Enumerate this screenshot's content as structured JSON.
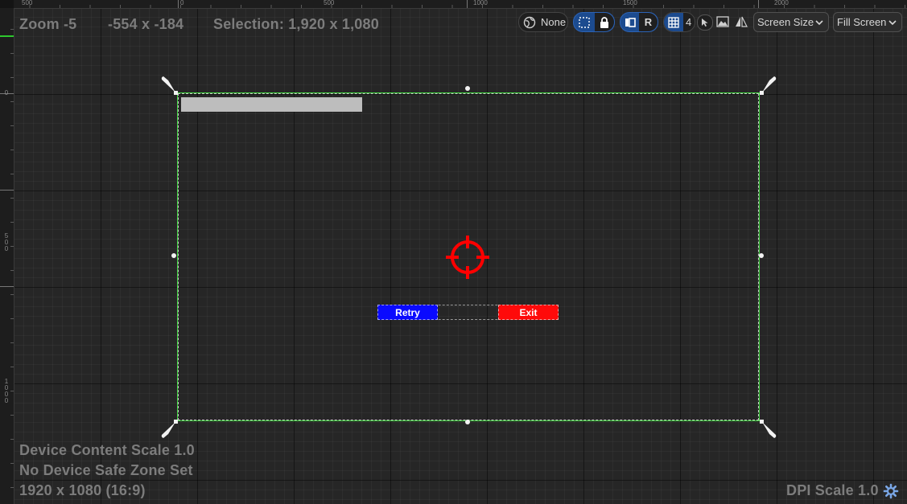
{
  "viewport": {
    "zoom_label": "Zoom -5",
    "cursor_coords": "-554 x -184",
    "selection_label": "Selection: 1,920 x 1,080",
    "device_content_scale": "Device Content Scale 1.0",
    "safe_zone": "No Device Safe Zone Set",
    "resolution": "1920 x 1080 (16:9)",
    "dpi_scale": "DPI Scale 1.0"
  },
  "ruler": {
    "top_labels": [
      "500",
      "0",
      "500",
      "1000",
      "1500",
      "2000"
    ],
    "left_labels": [
      "0",
      "500",
      "1000"
    ]
  },
  "toolbar": {
    "localization": "None",
    "respect_locks_icon": "lock-icon",
    "refresh_label": "R",
    "grid_snap_value": "4",
    "screen_size_label": "Screen Size",
    "fill_screen_label": "Fill Screen"
  },
  "widgets": {
    "retry_label": "Retry",
    "exit_label": "Exit",
    "retry_color": "#0a0aff",
    "exit_color": "#ff0a0a",
    "crosshair_color": "#ff0000",
    "progress_color": "#bdbdbd"
  },
  "colors": {
    "screen_border": "#3ed23e",
    "background": "#262626"
  }
}
